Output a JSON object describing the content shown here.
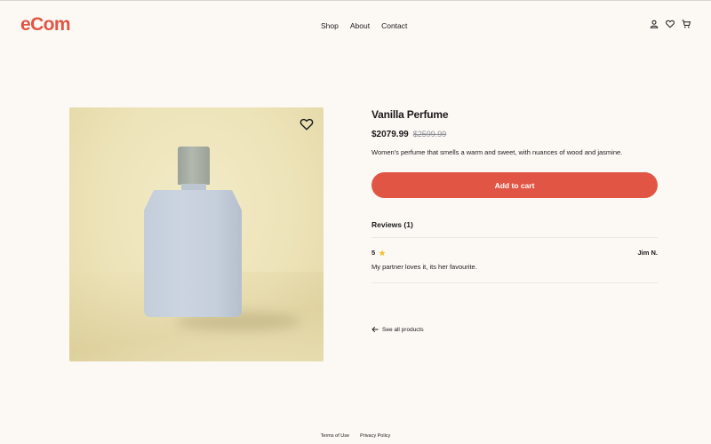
{
  "header": {
    "logo": "eCom",
    "nav": [
      "Shop",
      "About",
      "Contact"
    ],
    "icons": [
      "user-icon",
      "heart-icon",
      "cart-icon"
    ]
  },
  "product": {
    "title": "Vanilla Perfume",
    "price": "$2079.99",
    "old_price": "$2599.99",
    "description": "Women's perfume that smells a warm and sweet, with nuances of wood and jasmine.",
    "add_to_cart": "Add to cart",
    "favorite_icon": "heart-outline-icon"
  },
  "reviews": {
    "heading": "Reviews (1)",
    "items": [
      {
        "rating": "5",
        "author": "Jim N.",
        "text": "My partner loves it, its her favourite."
      }
    ]
  },
  "back_link": "See all products",
  "footer": {
    "links": [
      "Terms of Use",
      "Privacy Policy"
    ]
  },
  "colors": {
    "accent": "#e15544",
    "background": "#fcf9f5",
    "star": "#f2c230"
  }
}
